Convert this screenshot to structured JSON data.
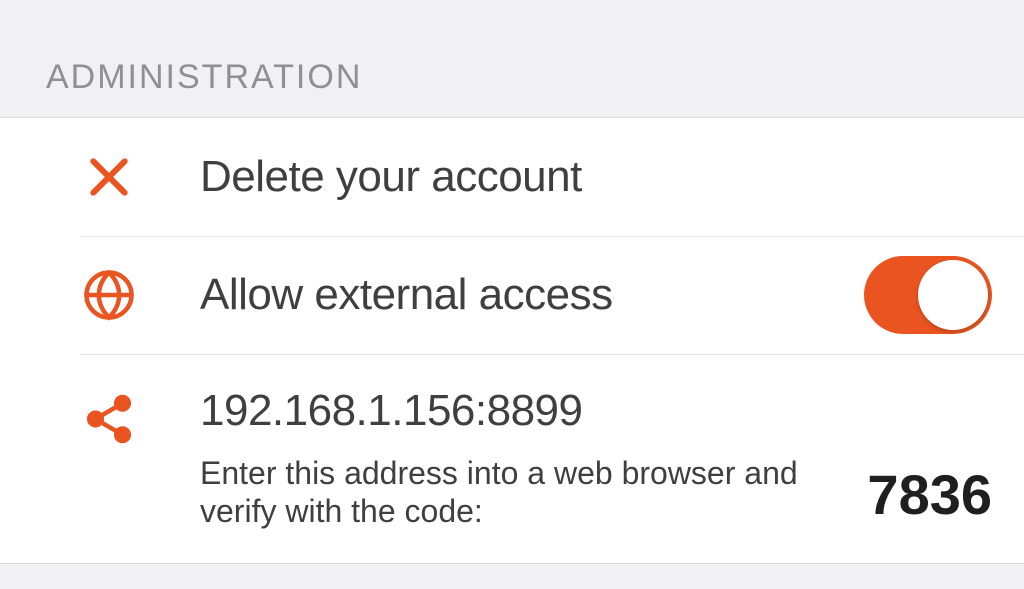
{
  "accent": "#e95420",
  "section": {
    "title": "ADMINISTRATION"
  },
  "rows": {
    "delete": {
      "label": "Delete your account"
    },
    "external": {
      "label": "Allow external access",
      "toggle_on": true
    },
    "share": {
      "address": "192.168.1.156:8899",
      "hint": "Enter this address into a web browser and verify with the code:",
      "code": "7836"
    }
  }
}
